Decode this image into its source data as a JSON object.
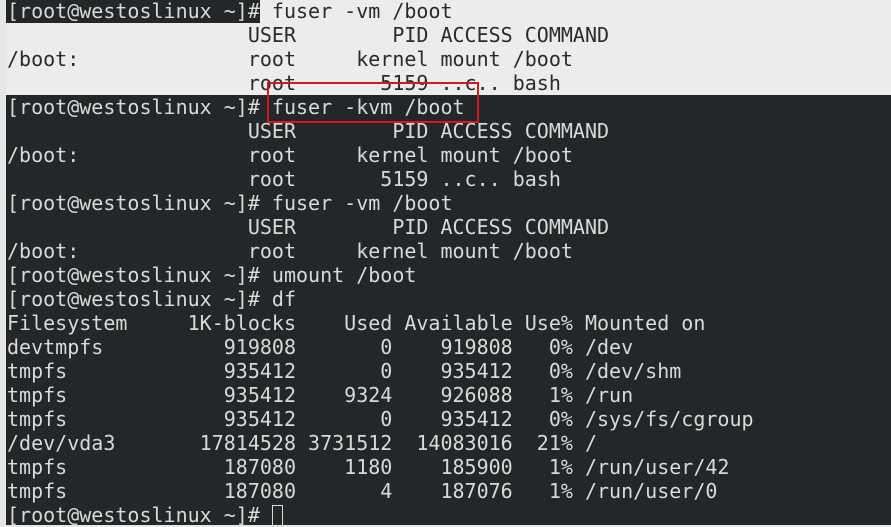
{
  "prompt": "[root@westoslinux ~]# ",
  "lines": [
    {
      "text": "[root@westoslinux ~]#",
      "rest": " fuser -vm /boot",
      "style": "partial"
    },
    {
      "text": "                    USER        PID ACCESS COMMAND",
      "style": "sel"
    },
    {
      "text": "/boot:              root     kernel mount /boot",
      "style": "sel"
    },
    {
      "text": "                    root       5159 ..c.. bash",
      "style": "sel"
    },
    {
      "text": "[root@westoslinux ~]# fuser -kvm /boot"
    },
    {
      "text": "                    USER        PID ACCESS COMMAND"
    },
    {
      "text": "/boot:              root     kernel mount /boot"
    },
    {
      "text": "                    root       5159 ..c.. bash"
    },
    {
      "text": "[root@westoslinux ~]# fuser -vm /boot"
    },
    {
      "text": "                    USER        PID ACCESS COMMAND"
    },
    {
      "text": "/boot:              root     kernel mount /boot"
    },
    {
      "text": "[root@westoslinux ~]# umount /boot"
    },
    {
      "text": "[root@westoslinux ~]# df"
    },
    {
      "text": "Filesystem     1K-blocks    Used Available Use% Mounted on"
    },
    {
      "text": "devtmpfs          919808       0    919808   0% /dev"
    },
    {
      "text": "tmpfs             935412       0    935412   0% /dev/shm"
    },
    {
      "text": "tmpfs             935412    9324    926088   1% /run"
    },
    {
      "text": "tmpfs             935412       0    935412   0% /sys/fs/cgroup"
    },
    {
      "text": "/dev/vda3       17814528 3731512  14083016  21% /"
    },
    {
      "text": "tmpfs             187080    1180    185900   1% /run/user/42"
    },
    {
      "text": "tmpfs             187080       4    187076   1% /run/user/0"
    },
    {
      "text": "[root@westoslinux ~]# ",
      "cursor": true
    }
  ],
  "colors": {
    "background": "#24272a",
    "foreground": "#d8dad6",
    "selection": "#ececec",
    "highlight_box": "#d11b1b"
  }
}
